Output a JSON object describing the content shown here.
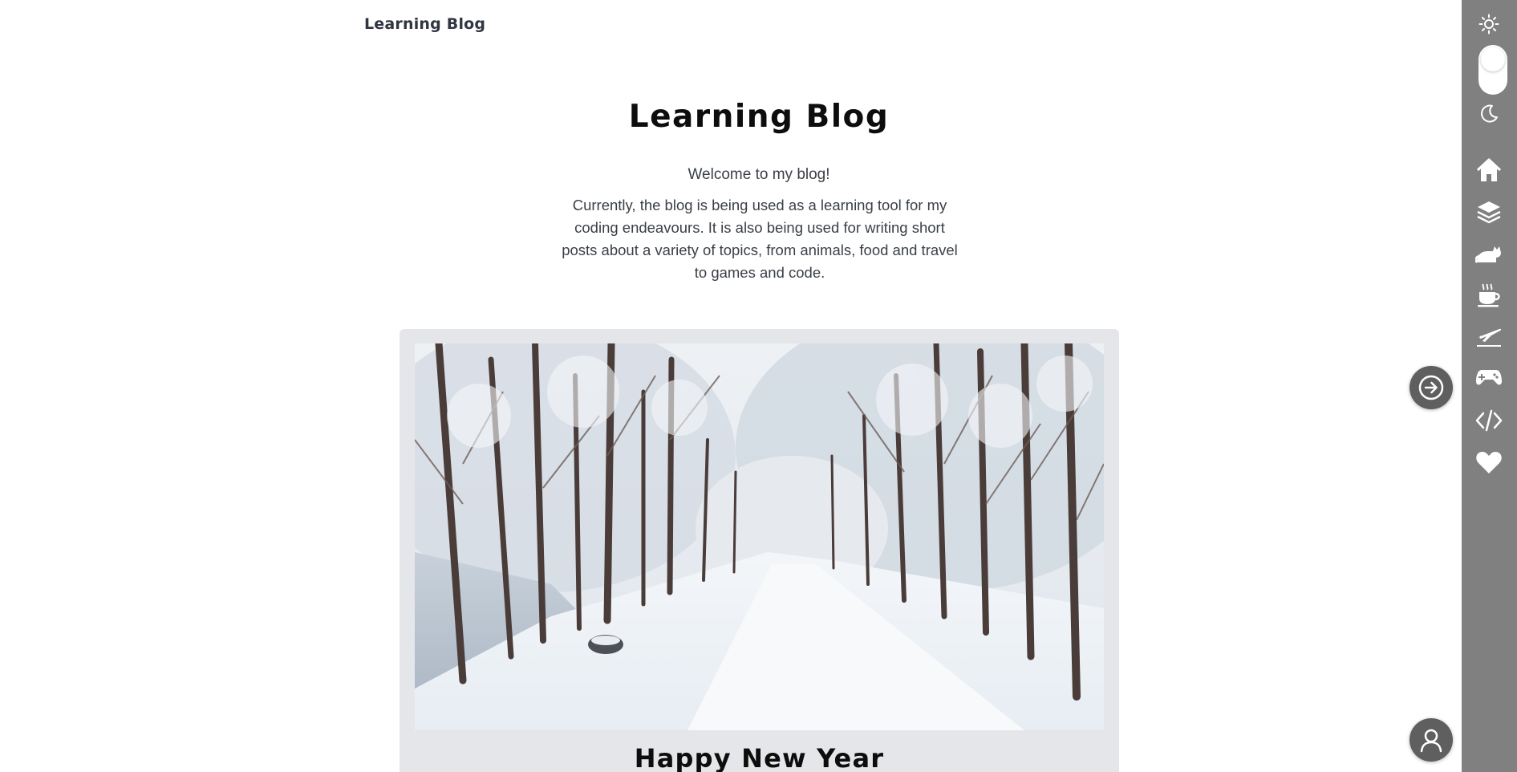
{
  "header": {
    "brand": "Learning Blog"
  },
  "hero": {
    "title": "Learning Blog",
    "welcome": "Welcome to my blog!",
    "description": "Currently, the blog is being used as a learning tool for my coding endeavours. It is also being used for writing short posts about a variety of topics, from animals, food and travel to games and code."
  },
  "post": {
    "title": "Happy New Year",
    "image_icon": "snowy-forest-path-image"
  },
  "sidebar": {
    "bg_color": "#808080",
    "theme_toggle": {
      "light_icon": "sun-icon",
      "dark_icon": "moon-icon"
    },
    "nav": [
      {
        "icon": "home-icon"
      },
      {
        "icon": "layers-icon"
      },
      {
        "icon": "cat-icon"
      },
      {
        "icon": "coffee-icon"
      },
      {
        "icon": "plane-icon"
      },
      {
        "icon": "gamepad-icon"
      },
      {
        "icon": "code-icon"
      },
      {
        "icon": "heart-icon"
      }
    ]
  },
  "actions": {
    "login_icon": "arrow-right-circle-icon",
    "account_icon": "user-icon",
    "fab_color": "#5f5f5f"
  }
}
